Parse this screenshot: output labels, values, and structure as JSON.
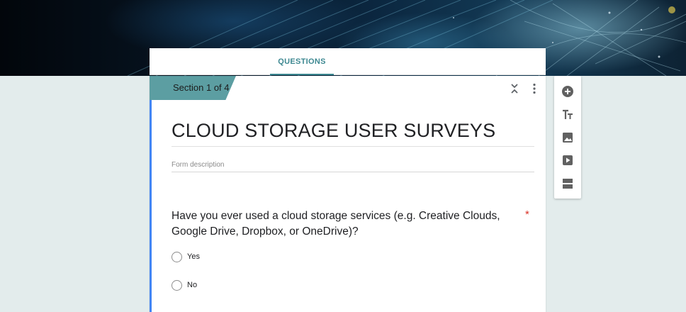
{
  "tabs": {
    "questions": "QUESTIONS"
  },
  "section": {
    "label": "Section 1 of 4"
  },
  "form": {
    "title": "CLOUD STORAGE USER SURVEYS",
    "description_placeholder": "Form description"
  },
  "question": {
    "text": "Have you ever used a cloud storage services (e.g. Creative Clouds, Google Drive, Dropbox, or OneDrive)?",
    "required_marker": "*",
    "options": [
      "Yes",
      "No"
    ]
  },
  "toolbar": {
    "icons": [
      "add-question-icon",
      "add-title-icon",
      "add-image-icon",
      "add-video-icon",
      "add-section-icon"
    ]
  },
  "colors": {
    "accent": "#3d8891",
    "section_tab": "#5c9ea2",
    "left_border": "#4285f4",
    "required": "#d93025",
    "page_background": "#e3ecec"
  }
}
